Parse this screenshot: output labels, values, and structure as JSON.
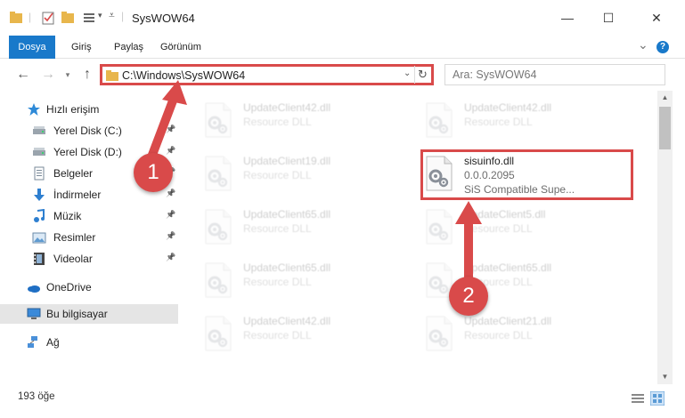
{
  "window": {
    "title": "SysWOW64",
    "minimize": "—",
    "maximize": "☐",
    "close": "✕"
  },
  "ribbon": {
    "tabs": [
      "Dosya",
      "Giriş",
      "Paylaş",
      "Görünüm"
    ],
    "expand": "⌄",
    "help": "?"
  },
  "address": {
    "path": "C:\\Windows\\SysWOW64",
    "search_placeholder": "Ara: SysWOW64"
  },
  "nav": {
    "items": [
      {
        "label": "Hızlı erişim",
        "icon": "star-icon",
        "pinned": false
      },
      {
        "label": "Yerel Disk (C:)",
        "icon": "drive-icon",
        "pinned": true
      },
      {
        "label": "Yerel Disk (D:)",
        "icon": "drive-icon",
        "pinned": true
      },
      {
        "label": "Belgeler",
        "icon": "documents-icon",
        "pinned": true
      },
      {
        "label": "İndirmeler",
        "icon": "download-icon",
        "pinned": true
      },
      {
        "label": "Müzik",
        "icon": "music-icon",
        "pinned": true
      },
      {
        "label": "Resimler",
        "icon": "pictures-icon",
        "pinned": true
      },
      {
        "label": "Videolar",
        "icon": "videos-icon",
        "pinned": true
      },
      {
        "label": "OneDrive",
        "icon": "cloud-icon",
        "pinned": false
      },
      {
        "label": "Bu bilgisayar",
        "icon": "computer-icon",
        "pinned": false
      },
      {
        "label": "Ağ",
        "icon": "network-icon",
        "pinned": false
      }
    ]
  },
  "files": [
    {
      "name": "UpdateClient42.dll",
      "sub": "Resource DLL"
    },
    {
      "name": "UpdateClient42.dll",
      "sub": "Resource DLL"
    },
    {
      "name": "UpdateClient19.dll",
      "sub": "Resource DLL"
    },
    {
      "name": "sisuinfo.dll",
      "sub": "0.0.0.2095",
      "sub2": "SiS Compatible Supe..."
    },
    {
      "name": "UpdateClient65.dll",
      "sub": "Resource DLL"
    },
    {
      "name": "UpdateClient5.dll",
      "sub": "Resource DLL"
    },
    {
      "name": "UpdateClient65.dll",
      "sub": "Resource DLL"
    },
    {
      "name": "UpdateClient65.dll",
      "sub": "Resource DLL"
    },
    {
      "name": "UpdateClient42.dll",
      "sub": "Resource DLL"
    },
    {
      "name": "UpdateClient21.dll",
      "sub": "Resource DLL"
    }
  ],
  "status": {
    "count": "193 öğe"
  },
  "annotations": {
    "step1": "1",
    "step2": "2"
  },
  "colors": {
    "accent": "#1979ca",
    "highlight": "#d94a4a"
  }
}
